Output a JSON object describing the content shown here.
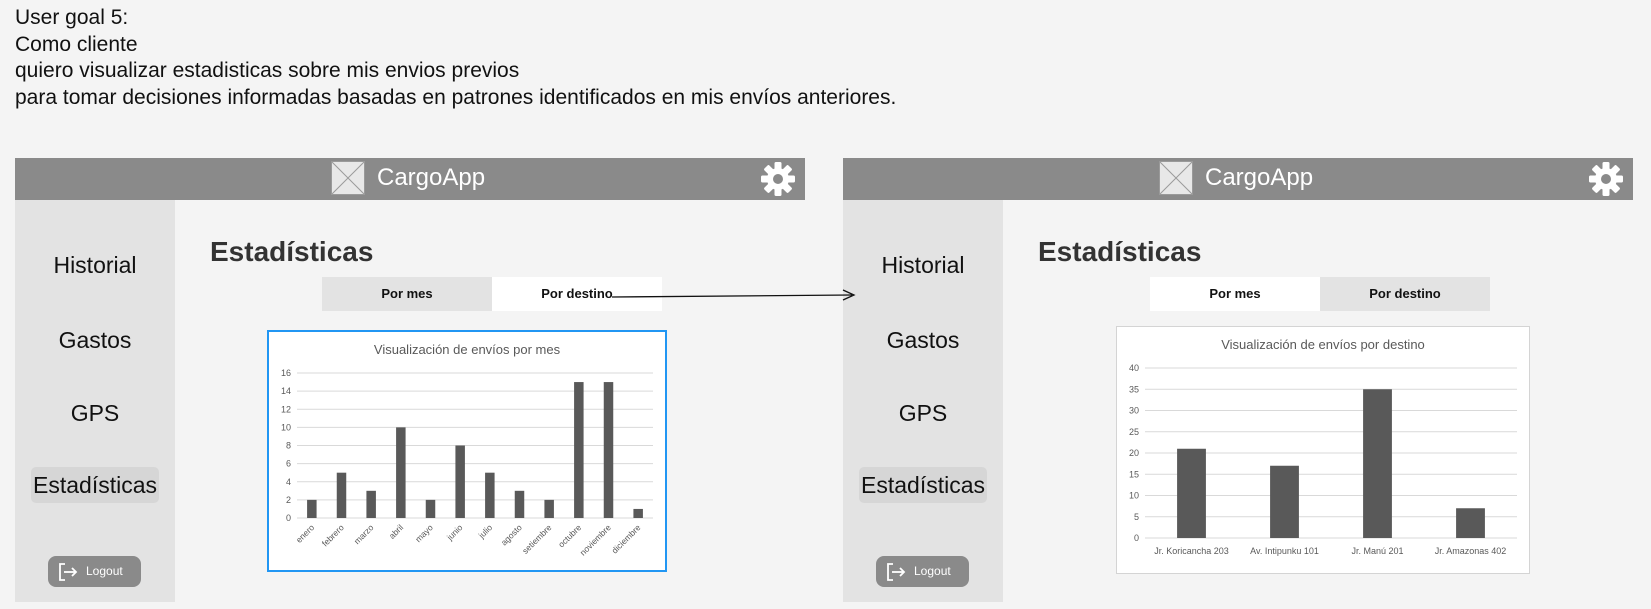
{
  "user_goal": {
    "lines": [
      "User goal 5:",
      "Como cliente",
      "quiero visualizar estadisticas sobre mis envios previos",
      "para tomar decisiones informadas basadas en patrones identificados en mis envíos anteriores."
    ]
  },
  "screens": [
    {
      "header": {
        "title": "CargoApp",
        "logo_icon": "image-placeholder-icon",
        "settings_icon": "gear-icon"
      },
      "sidebar": {
        "items": [
          {
            "label": "Historial"
          },
          {
            "label": "Gastos"
          },
          {
            "label": "GPS"
          },
          {
            "label": "Estadísticas",
            "active": true
          }
        ],
        "logout": {
          "label": "Logout",
          "icon": "logout-icon"
        }
      },
      "main": {
        "title": "Estadísticas",
        "tabs": [
          {
            "label": "Por mes",
            "active": false
          },
          {
            "label": "Por destino",
            "active": true
          }
        ]
      }
    },
    {
      "header": {
        "title": "CargoApp",
        "logo_icon": "image-placeholder-icon",
        "settings_icon": "gear-icon"
      },
      "sidebar": {
        "items": [
          {
            "label": "Historial"
          },
          {
            "label": "Gastos"
          },
          {
            "label": "GPS"
          },
          {
            "label": "Estadísticas",
            "active": true
          }
        ],
        "logout": {
          "label": "Logout",
          "icon": "logout-icon"
        }
      },
      "main": {
        "title": "Estadísticas",
        "tabs": [
          {
            "label": "Por mes",
            "active": true
          },
          {
            "label": "Por destino",
            "active": false
          }
        ]
      }
    }
  ],
  "colors": {
    "header": "#8a8a8a",
    "sidebar": "#e3e3e3",
    "bar": "#595959",
    "selected_border": "#2196f3"
  },
  "chart_data": [
    {
      "type": "bar",
      "title": "Visualización de envíos por mes",
      "categories": [
        "enero",
        "febrero",
        "marzo",
        "abril",
        "mayo",
        "junio",
        "julio",
        "agosto",
        "setiembre",
        "octubre",
        "noviembre",
        "diciembre"
      ],
      "values": [
        2,
        5,
        3,
        10,
        2,
        8,
        5,
        3,
        2,
        15,
        15,
        1
      ],
      "yticks": [
        "0",
        "2",
        "4",
        "6",
        "8",
        "10",
        "12",
        "14",
        "16"
      ],
      "ylim": [
        0,
        16
      ],
      "grid": true,
      "xlabel": "",
      "ylabel": ""
    },
    {
      "type": "bar",
      "title": "Visualización de envíos por destino",
      "categories": [
        "Jr. Koricancha 203",
        "Av. Intipunku 101",
        "Jr. Manú 201",
        "Jr. Amazonas 402"
      ],
      "values": [
        21,
        17,
        35,
        7
      ],
      "yticks": [
        "0",
        "5",
        "10",
        "15",
        "20",
        "25",
        "30",
        "35",
        "40"
      ],
      "ylim": [
        0,
        40
      ],
      "grid": true,
      "xlabel": "",
      "ylabel": ""
    }
  ]
}
